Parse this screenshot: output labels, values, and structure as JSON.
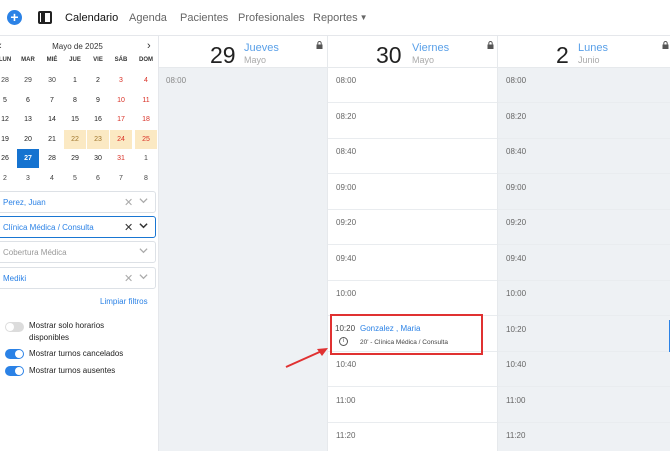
{
  "nav": {
    "items": [
      {
        "label": "Calendario",
        "active": true
      },
      {
        "label": "Agenda",
        "active": false
      },
      {
        "label": "Pacientes",
        "active": false
      },
      {
        "label": "Profesionales",
        "active": false
      },
      {
        "label": "Reportes",
        "active": false,
        "dropdown": true
      }
    ],
    "plus_icon": "plus-circle-icon",
    "panel_icon": "sidebar-toggle-icon"
  },
  "mini_calendar": {
    "title": "Mayo de 2025",
    "prev": "‹",
    "next": "›",
    "weekdays": [
      "LUN",
      "MAR",
      "MIÉ",
      "JUE",
      "VIE",
      "SÁB",
      "DOM"
    ],
    "weeks": [
      [
        "28",
        "29",
        "30",
        "1",
        "2",
        "3",
        "4"
      ],
      [
        "5",
        "6",
        "7",
        "8",
        "9",
        "10",
        "11"
      ],
      [
        "12",
        "13",
        "14",
        "15",
        "16",
        "17",
        "18"
      ],
      [
        "19",
        "20",
        "21",
        "22",
        "23",
        "24",
        "25"
      ],
      [
        "26",
        "27",
        "28",
        "29",
        "30",
        "31",
        "1"
      ],
      [
        "2",
        "3",
        "4",
        "5",
        "6",
        "7",
        "8"
      ]
    ],
    "selected": "27",
    "highlighted": [
      "22",
      "23",
      "24",
      "25"
    ]
  },
  "filters": {
    "professional": "Perez, Juan",
    "specialty": "Clínica Médica / Consulta",
    "coverage_placeholder": "Cobertura Médica",
    "coverage_plan": "Mediki",
    "clear": "Limpiar filtros"
  },
  "toggles": [
    {
      "label": "Mostrar solo horarios disponibles",
      "on": false
    },
    {
      "label": "Mostrar turnos cancelados",
      "on": true
    },
    {
      "label": "Mostrar turnos ausentes",
      "on": true
    }
  ],
  "columns": [
    {
      "day_number": "29",
      "day_name": "Jueves",
      "month": "Mayo",
      "slots": [
        "08:00"
      ]
    },
    {
      "day_number": "30",
      "day_name": "Viernes",
      "month": "Mayo",
      "slots": [
        "08:00",
        "08:20",
        "08:40",
        "09:00",
        "09:20",
        "09:40",
        "10:00",
        "",
        "10:40",
        "11:00",
        "11:20"
      ]
    },
    {
      "day_number": "2",
      "day_name": "Lunes",
      "month": "Junio",
      "slots": [
        "08:00",
        "08:20",
        "08:40",
        "09:00",
        "09:20",
        "09:40",
        "10:00",
        "10:20",
        "10:40",
        "11:00",
        "11:20"
      ]
    }
  ],
  "appointment": {
    "time": "10:20",
    "patient": "Gonzalez , Maria",
    "info_icon": "i",
    "description": "20' - Clínica Médica / Consulta"
  },
  "colors": {
    "accent": "#2b82e6",
    "selected_day": "#1573d0",
    "highlight_day": "#fbe9c3",
    "weekend_red": "#d93025",
    "annotation_red": "#e03131",
    "unavailable_col": "#eef1f4"
  }
}
